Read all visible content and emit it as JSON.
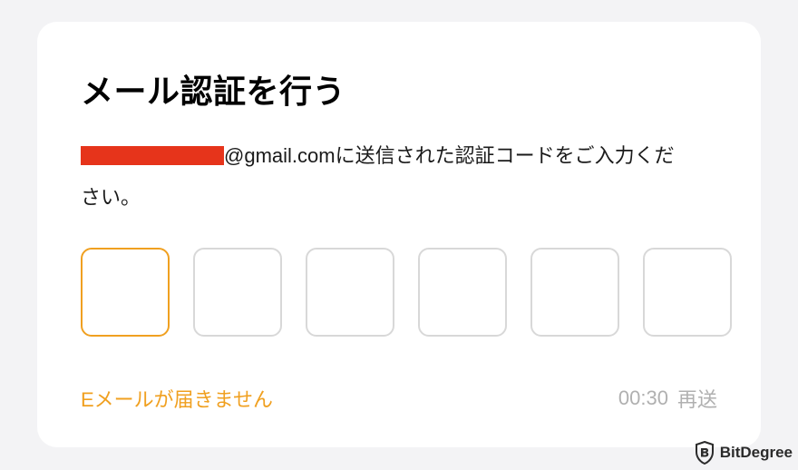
{
  "title": "メール認証を行う",
  "instruction": {
    "email_suffix": "@gmail.com",
    "text_after_email": " に送信された認証コードをご入力くだ",
    "text_line2": "さい。"
  },
  "code_inputs": {
    "count": 6,
    "focused_index": 0
  },
  "footer": {
    "not_received": "Eメールが届きません",
    "timer": "00:30",
    "resend": "再送"
  },
  "watermark": {
    "label": "BitDegree"
  }
}
